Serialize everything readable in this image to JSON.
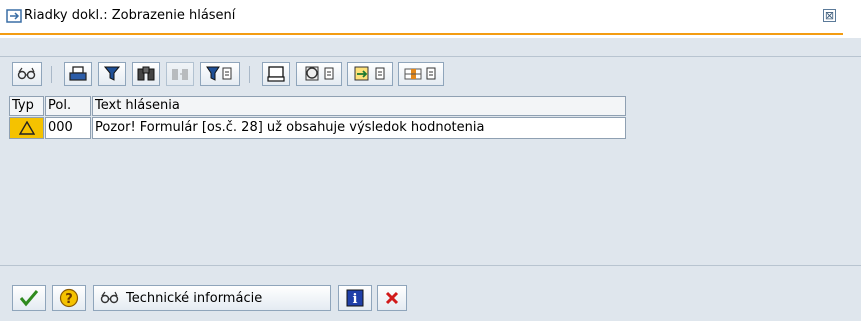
{
  "window": {
    "title": "Riadky dokl.: Zobrazenie hlásení",
    "close_label": "⊠"
  },
  "toolbar": {
    "buttons": [
      "glasses-icon",
      "print-icon",
      "filter-funnel-icon",
      "find-icon",
      "find-next-icon",
      "set-filter-icon",
      "print-preview-icon",
      "layout-icon",
      "export-icon",
      "column-select-icon"
    ]
  },
  "table": {
    "headers": [
      "Typ",
      "Pol.",
      "Text hlásenia"
    ],
    "rows": [
      {
        "type_icon": "warning-triangle-icon",
        "position": "000",
        "text": "Pozor! Formulár [os.č. 28] už obsahuje výsledok hodnotenia"
      }
    ]
  },
  "footer": {
    "tech_info_label": "Technické informácie"
  },
  "colors": {
    "accent": "#f39c12",
    "warning": "#f5c200",
    "background": "#dfe6ed"
  }
}
